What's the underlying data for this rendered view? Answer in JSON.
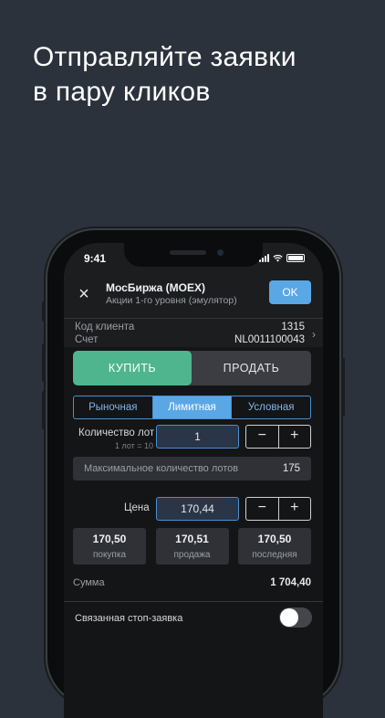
{
  "headline": {
    "line1": "Отправляйте заявки",
    "line2": "в пару кликов"
  },
  "status_bar": {
    "time": "9:41",
    "icons": [
      "cellular-signal-icon",
      "wifi-icon",
      "battery-icon"
    ]
  },
  "nav": {
    "close_icon": "×",
    "title": "МосБиржа (MOEX)",
    "subtitle": "Акции 1-го уровня (эмулятор)",
    "ok_label": "OK"
  },
  "client": {
    "code_label": "Код клиента",
    "code_value": "1315",
    "account_label": "Счет",
    "account_value": "NL0011100043",
    "chevron": "›"
  },
  "trade": {
    "buy_label": "КУПИТЬ",
    "sell_label": "ПРОДАТЬ",
    "selected": "buy"
  },
  "order_types": {
    "market": "Рыночная",
    "limit": "Лимитная",
    "conditional": "Условная",
    "selected": "limit"
  },
  "lots": {
    "label": "Количество лот",
    "sublabel": "1 лот = 10",
    "value": "1",
    "minus": "−",
    "plus": "+"
  },
  "max_lots": {
    "label": "Максимальное количество лотов",
    "value": "175"
  },
  "price": {
    "label": "Цена",
    "value": "170,44",
    "minus": "−",
    "plus": "+"
  },
  "quotes": [
    {
      "value": "170,50",
      "label": "покупка"
    },
    {
      "value": "170,51",
      "label": "продажа"
    },
    {
      "value": "170,50",
      "label": "последняя"
    }
  ],
  "sum": {
    "label": "Сумма",
    "value": "1 704,40"
  },
  "stop_order": {
    "label": "Связанная стоп-заявка",
    "enabled": false
  },
  "colors": {
    "background": "#2b323b",
    "buy": "#4fb58f",
    "accent": "#5aa7e6"
  }
}
